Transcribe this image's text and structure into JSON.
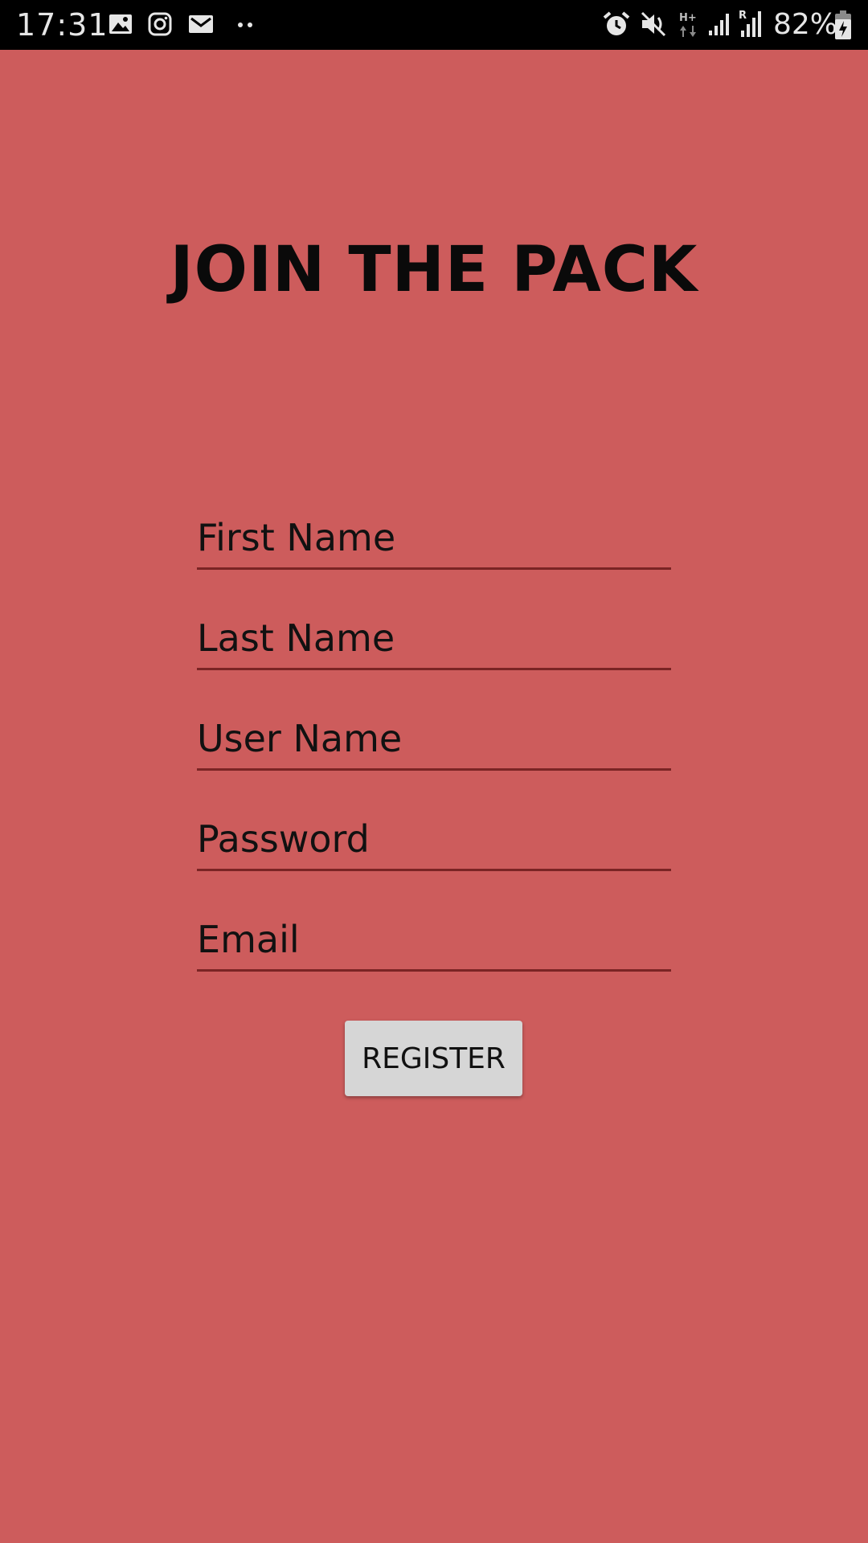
{
  "status_bar": {
    "time": "17:31",
    "battery": "82%",
    "left_icons": [
      "gallery-icon",
      "instagram-icon",
      "gmail-icon",
      "more-dots-icon"
    ],
    "right_icons": [
      "alarm-icon",
      "mute-icon",
      "hplus-data-icon",
      "signal-icon",
      "roaming-signal-icon",
      "battery-charging-icon"
    ]
  },
  "page": {
    "title": "JOIN THE PACK",
    "background": "#cd5c5c"
  },
  "form": {
    "first_name_placeholder": "First Name",
    "last_name_placeholder": "Last Name",
    "user_name_placeholder": "User Name",
    "password_placeholder": "Password",
    "email_placeholder": "Email",
    "register_label": "REGISTER"
  }
}
